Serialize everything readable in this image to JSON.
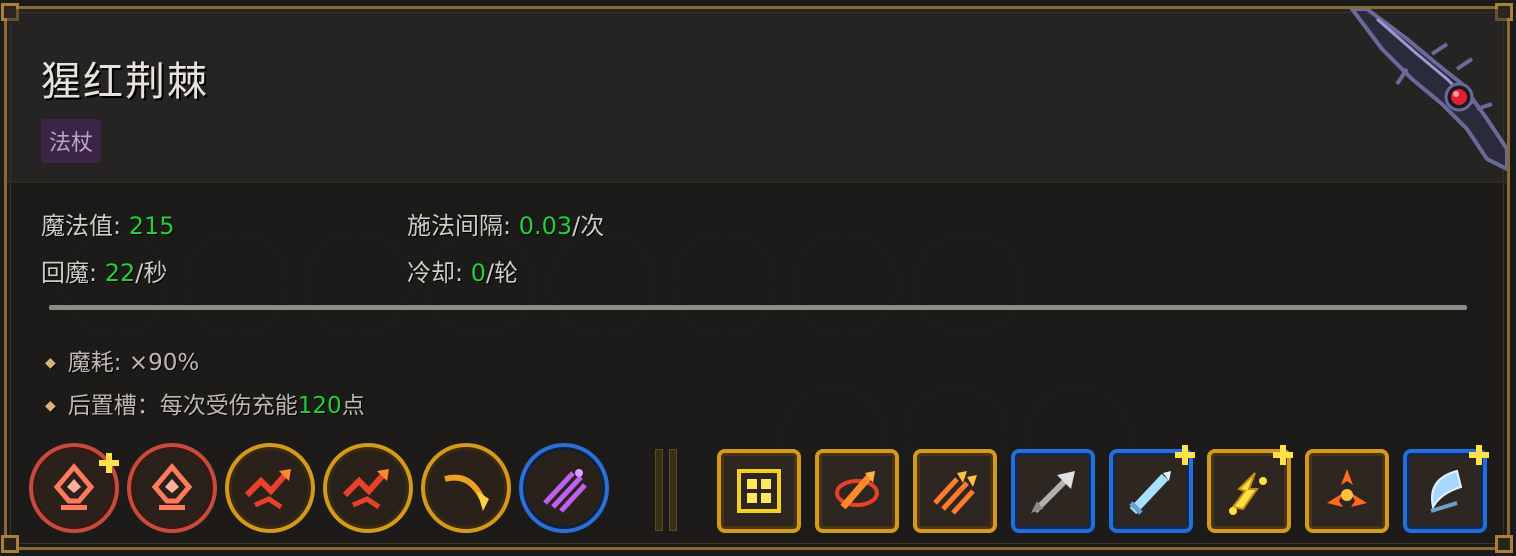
{
  "wand": {
    "name": "猩红荆棘",
    "type": "法杖"
  },
  "stats": {
    "mana_label": "魔法值: ",
    "mana_value": "215",
    "regen_label": "回魔: ",
    "regen_value": "22",
    "regen_unit": "/秒",
    "interval_label": "施法间隔: ",
    "interval_value": "0.03",
    "interval_unit": "/次",
    "cooldown_label": "冷却: ",
    "cooldown_value": "0",
    "cooldown_unit": "/轮"
  },
  "effects": [
    {
      "text_before": "魔耗: ×90%",
      "value": "",
      "text_after": ""
    },
    {
      "text_before": "后置槽：每次受伤充能",
      "value": "120",
      "text_after": "点"
    }
  ],
  "always_cast": [
    {
      "icon": "red-arrow-sigil-icon",
      "border": "red",
      "enhanced": true
    },
    {
      "icon": "red-arrow-sigil-icon",
      "border": "red",
      "enhanced": false
    },
    {
      "icon": "split-arrows-icon",
      "border": "gold",
      "enhanced": false
    },
    {
      "icon": "split-arrows-icon",
      "border": "gold",
      "enhanced": false
    },
    {
      "icon": "curved-flame-icon",
      "border": "gold",
      "enhanced": false
    },
    {
      "icon": "purple-triple-slash-icon",
      "border": "blue",
      "enhanced": false
    }
  ],
  "spells": [
    {
      "icon": "golden-cross-rune-icon",
      "border": "gold",
      "enhanced": false
    },
    {
      "icon": "fire-orbit-icon",
      "border": "gold",
      "enhanced": false
    },
    {
      "icon": "triple-fire-arrow-icon",
      "border": "gold",
      "enhanced": false
    },
    {
      "icon": "steel-arrow-icon",
      "border": "blue",
      "enhanced": false
    },
    {
      "icon": "ice-sword-icon",
      "border": "blue",
      "enhanced": true
    },
    {
      "icon": "lightning-chain-icon",
      "border": "gold",
      "enhanced": true
    },
    {
      "icon": "fire-burst-icon",
      "border": "gold",
      "enhanced": false
    },
    {
      "icon": "ice-crescent-icon",
      "border": "blue",
      "enhanced": true
    }
  ],
  "colors": {
    "accent_green": "#22d03a",
    "frame_gold": "#8b6a32",
    "slot_red": "#c74a3c",
    "slot_gold": "#d49a1c",
    "slot_blue": "#2c6fd6",
    "type_badge_bg": "#3b2446"
  }
}
